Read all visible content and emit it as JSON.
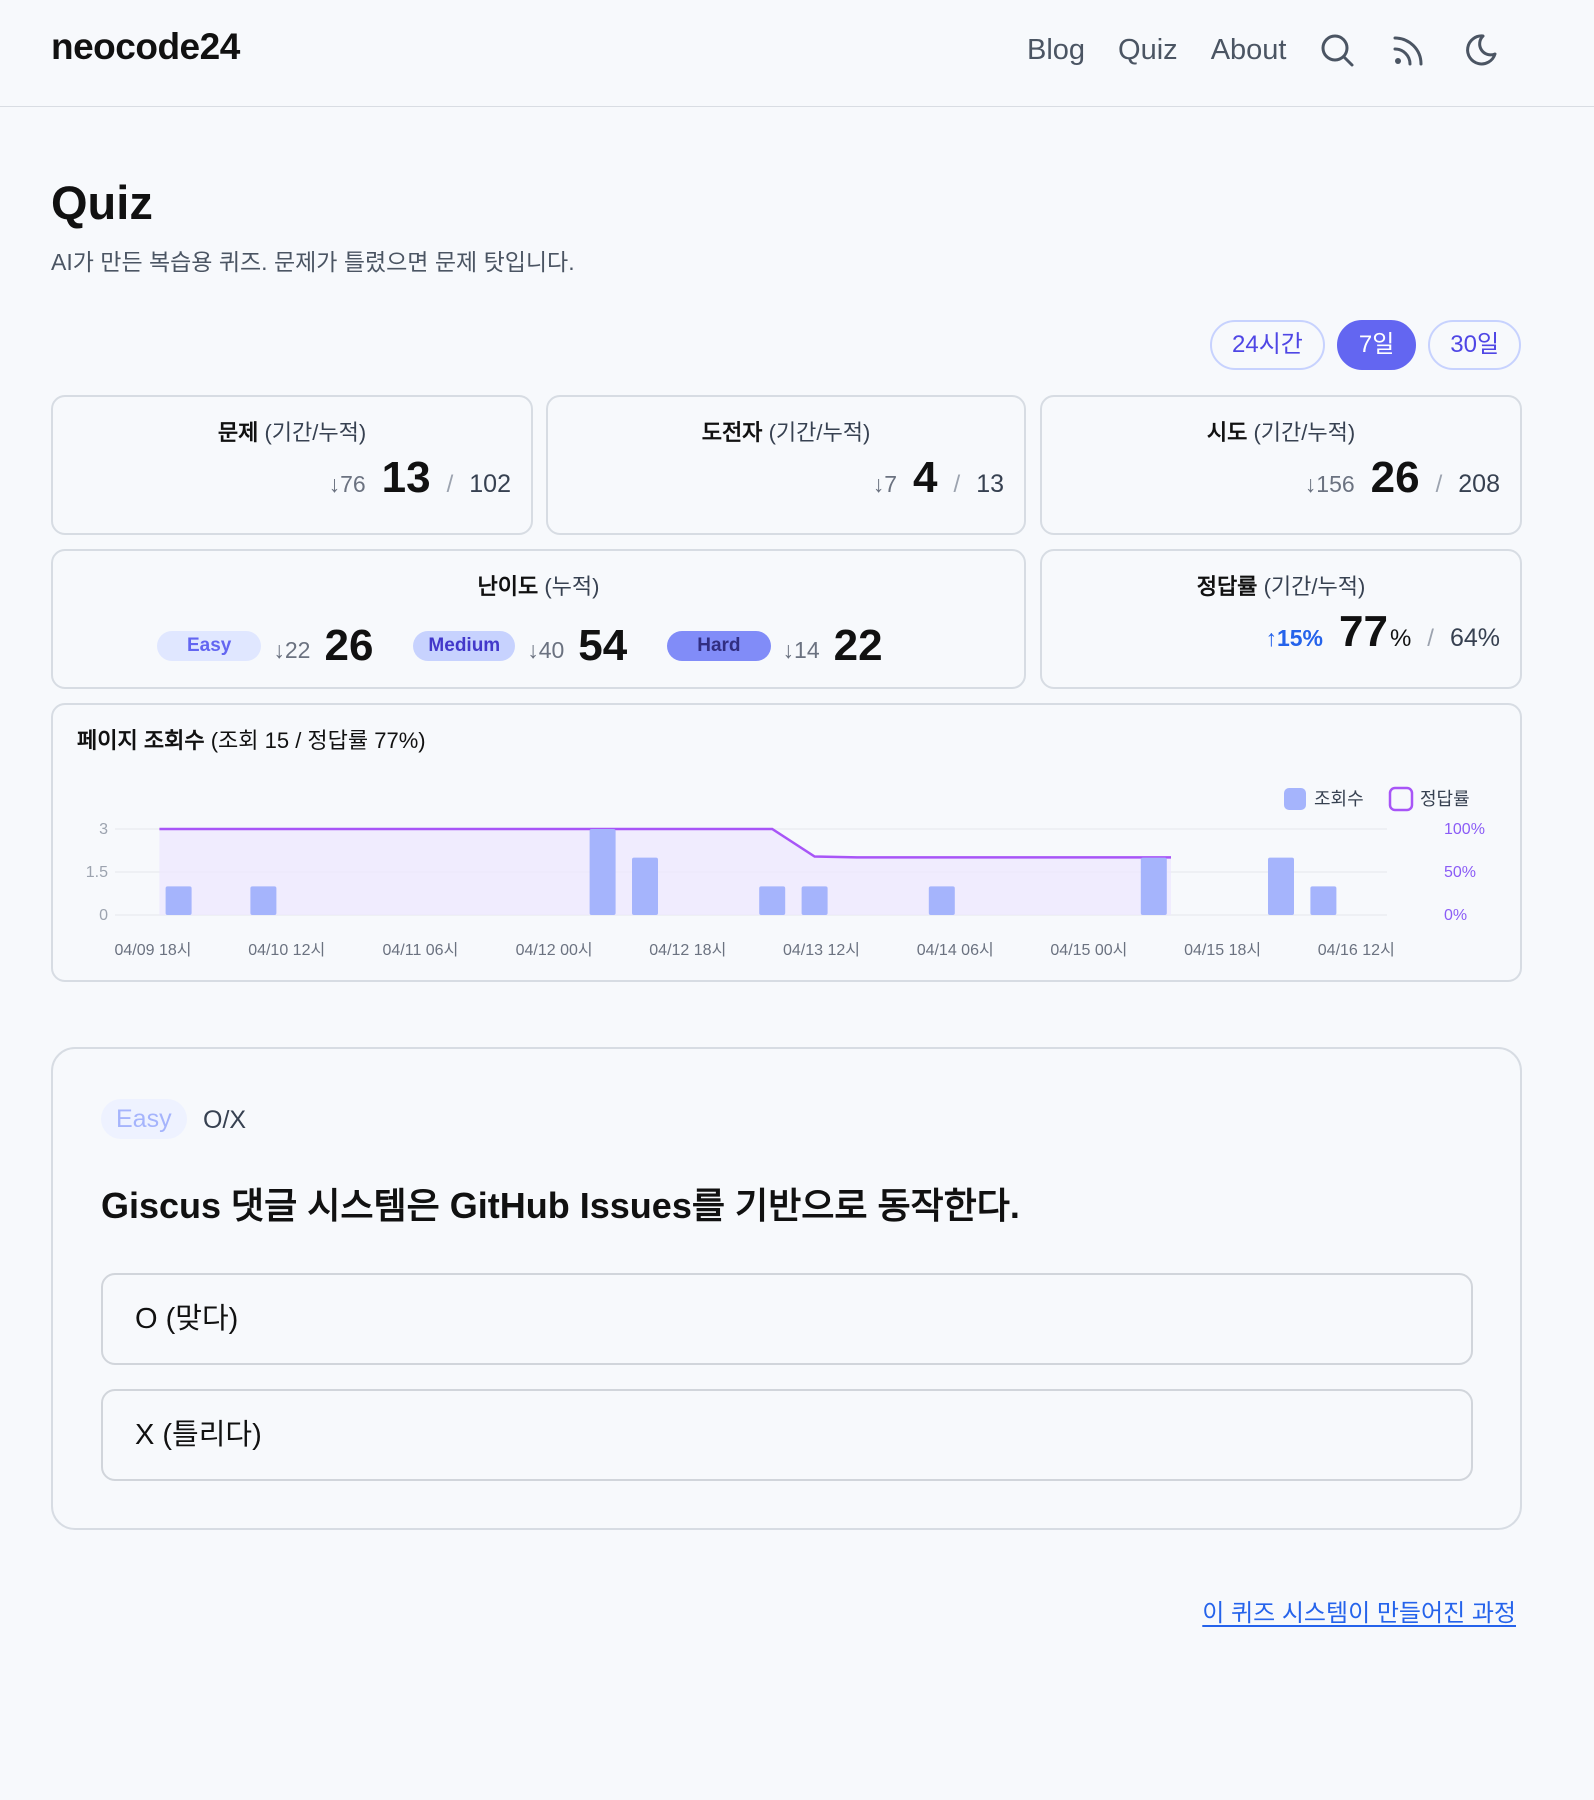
{
  "header": {
    "logo": "neocode24",
    "nav": [
      "Blog",
      "Quiz",
      "About"
    ],
    "icons": [
      "search-icon",
      "rss-icon",
      "moon-icon"
    ]
  },
  "page": {
    "title": "Quiz",
    "description": "AI가 만든 복습용 퀴즈. 문제가 틀렸으면 문제 탓입니다."
  },
  "period_tabs": [
    "24시간",
    "7일",
    "30일"
  ],
  "active_tab": "7일",
  "stats": {
    "problems": {
      "label": "문제",
      "sub": "(기간/누적)",
      "delta": "↓76",
      "value": "13",
      "total": "102"
    },
    "challengers": {
      "label": "도전자",
      "sub": "(기간/누적)",
      "delta": "↓7",
      "value": "4",
      "total": "13"
    },
    "attempts": {
      "label": "시도",
      "sub": "(기간/누적)",
      "delta": "↓156",
      "value": "26",
      "total": "208"
    },
    "difficulty": {
      "label": "난이도",
      "sub": "(누적)",
      "items": [
        {
          "name": "Easy",
          "delta": "↓22",
          "value": "26"
        },
        {
          "name": "Medium",
          "delta": "↓40",
          "value": "54"
        },
        {
          "name": "Hard",
          "delta": "↓14",
          "value": "22"
        }
      ]
    },
    "accuracy": {
      "label": "정답률",
      "sub": "(기간/누적)",
      "delta": "↑15%",
      "value": "77",
      "unit": "%",
      "total": "64%"
    }
  },
  "chart": {
    "title": "페이지 조회수",
    "title_sub": "(조회 15 / 정답률 77%)",
    "legend": [
      "조회수",
      "정답률"
    ]
  },
  "chart_data": {
    "type": "bar",
    "x_tick_labels": [
      "04/09 18시",
      "04/10 12시",
      "04/11 06시",
      "04/12 00시",
      "04/12 18시",
      "04/13 12시",
      "04/14 06시",
      "04/15 00시",
      "04/15 18시",
      "04/16 12시"
    ],
    "left_axis": {
      "ticks": [
        "3",
        "1.5",
        "0"
      ],
      "ylim": [
        0,
        3
      ]
    },
    "right_axis": {
      "ticks": [
        "100%",
        "50%",
        "0%"
      ],
      "ylim": [
        0,
        100
      ]
    },
    "series": [
      {
        "name": "조회수",
        "type": "bar",
        "color": "#a5b4fc",
        "x": [
          1,
          3,
          11,
          12,
          15,
          16,
          19,
          24,
          27,
          28
        ],
        "values": [
          1,
          1,
          3,
          2,
          1,
          1,
          1,
          2,
          2,
          1
        ]
      },
      {
        "name": "정답률",
        "type": "area",
        "color": "#a855f7",
        "x": [
          1,
          15,
          16,
          17,
          18,
          19,
          20,
          21,
          22,
          23,
          24
        ],
        "values": [
          100,
          100,
          68,
          67,
          67,
          67,
          67,
          67,
          67,
          67,
          67
        ]
      }
    ]
  },
  "quiz": {
    "difficulty": "Easy",
    "type": "O/X",
    "question": "Giscus 댓글 시스템은 GitHub Issues를 기반으로 동작한다.",
    "options": [
      "O (맞다)",
      "X (틀리다)"
    ]
  },
  "footer": {
    "link": "이 퀴즈 시스템이 만들어진 과정"
  }
}
